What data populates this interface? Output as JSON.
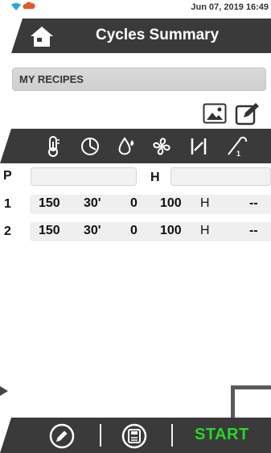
{
  "status": {
    "datetime": "Jun 07, 2019  16:49"
  },
  "header": {
    "title": "Cycles Summary",
    "home_icon": "home-icon"
  },
  "recipes": {
    "label": "MY RECIPES"
  },
  "toolbar": {
    "image_icon": "image-icon",
    "edit_icon": "edit-icon"
  },
  "columns": [
    {
      "icon": "thermometer-icon"
    },
    {
      "icon": "clock-icon"
    },
    {
      "icon": "humidity-drop-icon"
    },
    {
      "icon": "fan-icon"
    },
    {
      "icon": "damper-icon"
    },
    {
      "icon": "probe-icon"
    }
  ],
  "phase": {
    "p_label": "P",
    "p_value": "",
    "h_label": "H",
    "h_value": ""
  },
  "rows": [
    {
      "index": "1",
      "temp": "150",
      "time": "30'",
      "humidity": "0",
      "fan": "100",
      "damper": "H",
      "probe": "--"
    },
    {
      "index": "2",
      "temp": "150",
      "time": "30'",
      "humidity": "0",
      "fan": "100",
      "damper": "H",
      "probe": "--"
    }
  ],
  "bottom": {
    "start_label": "START",
    "edit_icon": "pencil-circle-icon",
    "save_icon": "save-icon"
  },
  "colors": {
    "bar": "#3a3a3a",
    "start": "#27d727",
    "accent_wifi": "#2aa7d8",
    "accent_cloud": "#e05a2b"
  }
}
